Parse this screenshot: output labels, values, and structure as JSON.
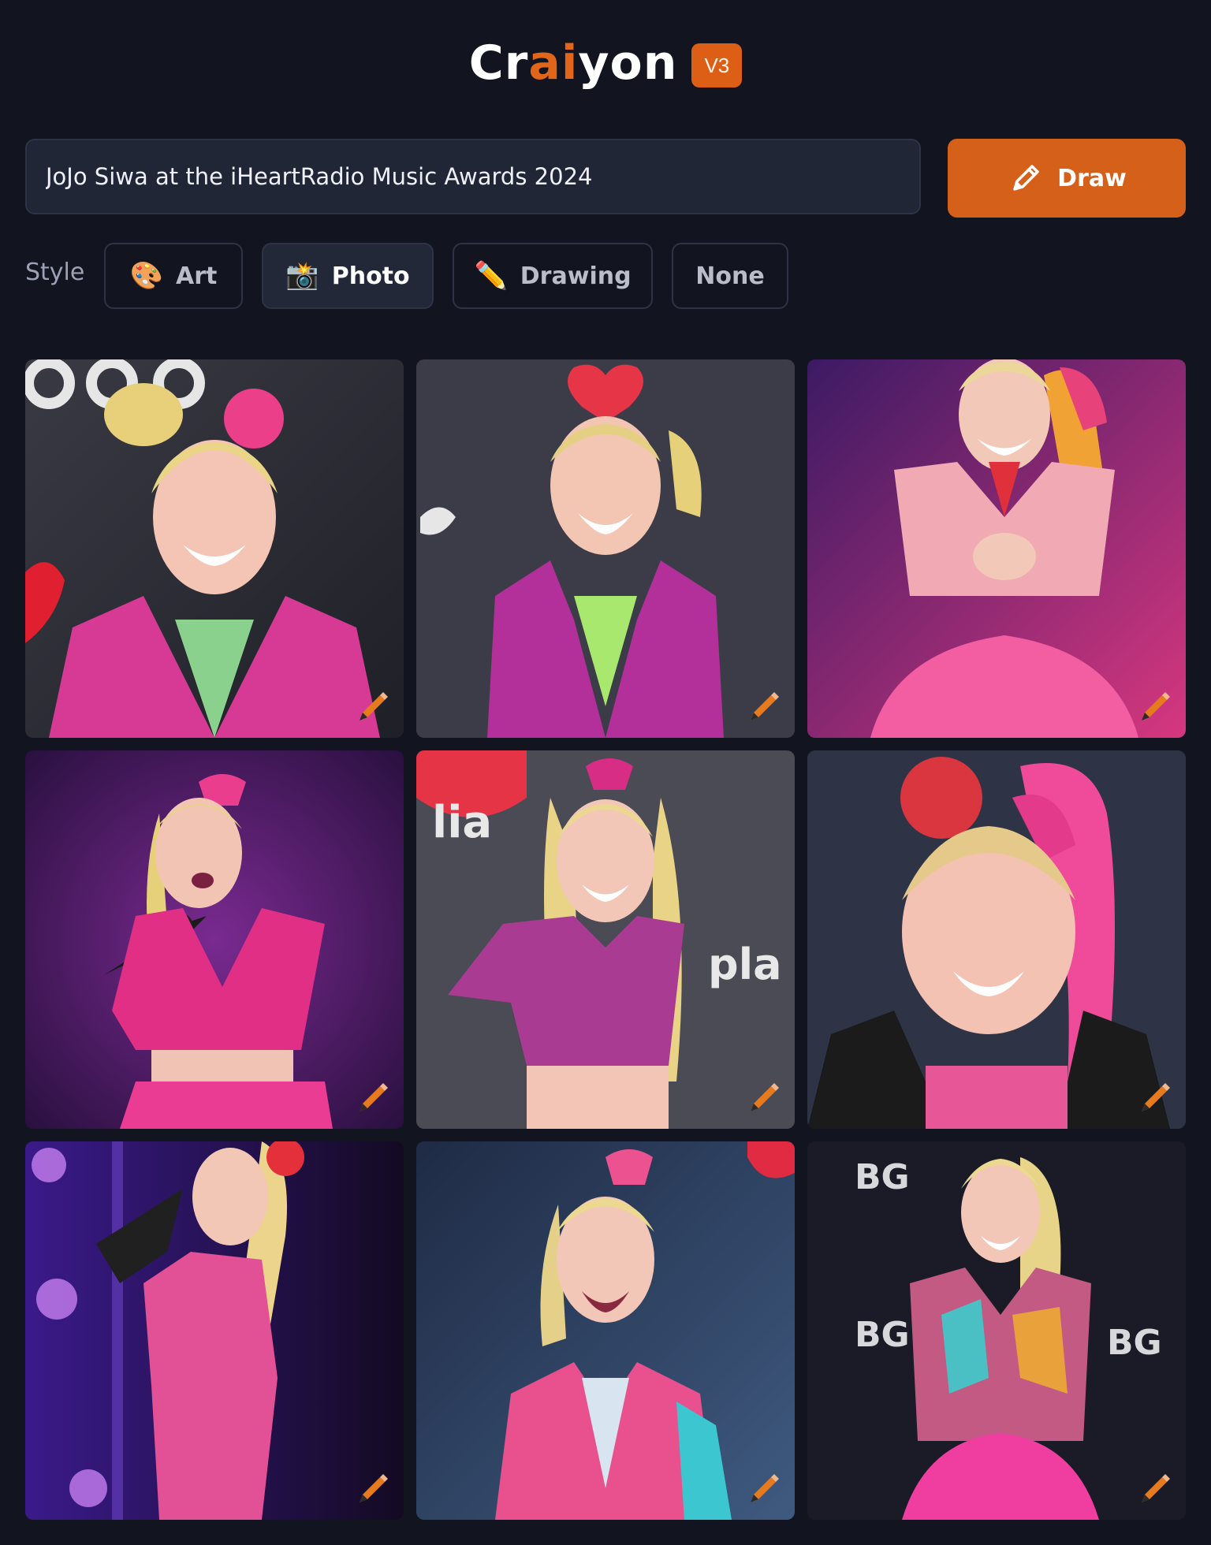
{
  "brand": {
    "logo_prefix": "Cr",
    "logo_accent": "ai",
    "logo_suffix": "yon",
    "version": "V3",
    "accent_color": "#e2661a"
  },
  "search": {
    "value": "JoJo Siwa at the iHeartRadio Music Awards 2024",
    "placeholder": ""
  },
  "draw_button": {
    "label": "Draw",
    "icon": "pencil-icon",
    "color": "#d5601a"
  },
  "style_selector": {
    "label": "Style",
    "selected": "Photo",
    "options": [
      {
        "label": "Art",
        "icon": "palette-icon"
      },
      {
        "label": "Photo",
        "icon": "camera-flash-icon"
      },
      {
        "label": "Drawing",
        "icon": "pencil-icon"
      },
      {
        "label": "None",
        "icon": ""
      }
    ]
  },
  "results": {
    "count": 9,
    "tile_icon": "edit-pencil-icon",
    "images": [
      {
        "subject": "pink-sequin-jacket"
      },
      {
        "subject": "purple-sequin-fringe-vest"
      },
      {
        "subject": "pink-embellished-dress"
      },
      {
        "subject": "singing-with-microphone"
      },
      {
        "subject": "purple-crop-top"
      },
      {
        "subject": "pink-bow-closeup"
      },
      {
        "subject": "singing-pink-suit"
      },
      {
        "subject": "pink-jacket-rainbow-sleeve"
      },
      {
        "subject": "multicolor-sequin-outfit"
      }
    ]
  }
}
